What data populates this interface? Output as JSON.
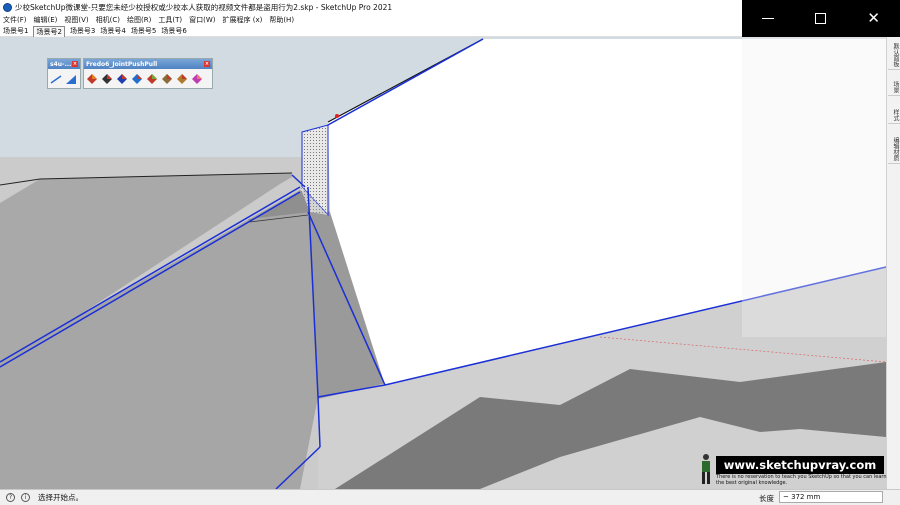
{
  "window": {
    "title": "少校SketchUp微课堂-只要您未经少校授权或少校本人获取的视频文件都是盗用行为2.skp - SketchUp Pro 2021"
  },
  "menu": [
    {
      "label": "文件(F)"
    },
    {
      "label": "编辑(E)"
    },
    {
      "label": "视图(V)"
    },
    {
      "label": "相机(C)"
    },
    {
      "label": "绘图(R)"
    },
    {
      "label": "工具(T)"
    },
    {
      "label": "窗口(W)"
    },
    {
      "label": "扩展程序 (x)"
    },
    {
      "label": "帮助(H)"
    }
  ],
  "scenes": [
    {
      "label": "场景号1"
    },
    {
      "label": "场景号2"
    },
    {
      "label": "场景号3"
    },
    {
      "label": "场景号4"
    },
    {
      "label": "场景号5"
    },
    {
      "label": "场景号6"
    }
  ],
  "toolbars": {
    "s4u": {
      "title": "s4u-..."
    },
    "fredo": {
      "title": "Fredo6_JointPushPull"
    }
  },
  "tray_tabs": [
    {
      "label": "默认面板"
    },
    {
      "label": "场景"
    },
    {
      "label": "样式"
    },
    {
      "label": "编辑材质"
    }
  ],
  "status": {
    "hint": "选择开始点。",
    "measure_label": "长度",
    "measure_value": "~ 372 mm"
  },
  "watermark": {
    "url": "www.sketchupvray.com",
    "tagline": "There is no reservation to teach you SketchUp so that you can learn the best original knowledge."
  },
  "colors": {
    "edge_blue": "#1a2fd6",
    "face_gray": "#a8a8a8",
    "ground": "#c9c9c9"
  }
}
